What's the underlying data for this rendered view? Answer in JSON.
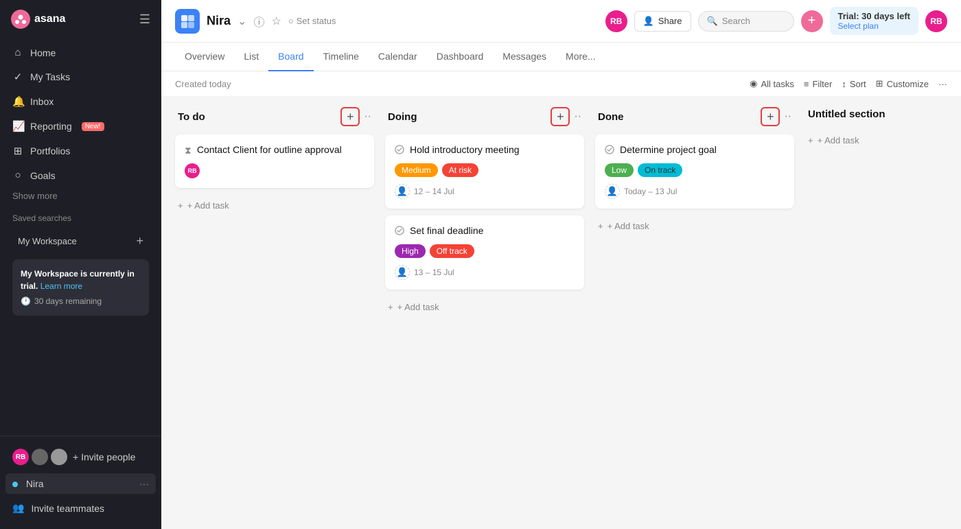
{
  "sidebar": {
    "logo_text": "asana",
    "hamburger": "☰",
    "nav_items": [
      {
        "label": "Home",
        "icon": "⌂",
        "id": "home"
      },
      {
        "label": "My Tasks",
        "icon": "✓",
        "id": "my-tasks"
      },
      {
        "label": "Inbox",
        "icon": "🔔",
        "id": "inbox"
      },
      {
        "label": "Reporting",
        "icon": "📈",
        "id": "reporting",
        "badge": "New!"
      },
      {
        "label": "Portfolios",
        "icon": "⊞",
        "id": "portfolios"
      },
      {
        "label": "Goals",
        "icon": "○",
        "id": "goals"
      }
    ],
    "show_more": "Show more",
    "saved_searches": "Saved searches",
    "my_workspace": "My Workspace",
    "trial_box": {
      "text1": "My Workspace is currently in trial.",
      "learn_more": "Learn more",
      "days_remaining": "30 days remaining"
    },
    "invite_people_label": "+ Invite people",
    "project_name": "Nira",
    "project_ellipsis": "···",
    "invite_teammates": "Invite teammates"
  },
  "topbar": {
    "project_icon": "▦",
    "project_name": "Nira",
    "set_status": "Set status",
    "share_label": "Share",
    "search_placeholder": "Search",
    "trial": {
      "title": "Trial: 30 days left",
      "select_plan": "Select plan"
    }
  },
  "nav_tabs": [
    {
      "label": "Overview",
      "id": "overview"
    },
    {
      "label": "List",
      "id": "list"
    },
    {
      "label": "Board",
      "id": "board",
      "active": true
    },
    {
      "label": "Timeline",
      "id": "timeline"
    },
    {
      "label": "Calendar",
      "id": "calendar"
    },
    {
      "label": "Dashboard",
      "id": "dashboard"
    },
    {
      "label": "Messages",
      "id": "messages"
    },
    {
      "label": "More...",
      "id": "more"
    }
  ],
  "sub_toolbar": {
    "created_today": "Created today",
    "all_tasks": "All tasks",
    "filter": "Filter",
    "sort": "Sort",
    "customize": "Customize",
    "dots": "···"
  },
  "board": {
    "columns": [
      {
        "id": "todo",
        "title": "To do",
        "tasks": [
          {
            "id": "task1",
            "title": "Contact Client for outline approval",
            "icon": "hourglass",
            "has_avatar": true,
            "avatar_text": "RB",
            "tags": []
          }
        ],
        "add_task_label": "+ Add task"
      },
      {
        "id": "doing",
        "title": "Doing",
        "tasks": [
          {
            "id": "task2",
            "title": "Hold introductory meeting",
            "icon": "circle-check",
            "tags": [
              "Medium",
              "At risk"
            ],
            "date": "12 – 14 Jul",
            "has_avatar": false
          },
          {
            "id": "task3",
            "title": "Set final deadline",
            "icon": "circle-check",
            "tags": [
              "High",
              "Off track"
            ],
            "date": "13 – 15 Jul",
            "has_avatar": false
          }
        ],
        "add_task_label": "+ Add task"
      },
      {
        "id": "done",
        "title": "Done",
        "tasks": [
          {
            "id": "task4",
            "title": "Determine project goal",
            "icon": "circle-check",
            "tags": [
              "Low",
              "On track"
            ],
            "date": "Today – 13 Jul",
            "has_avatar": false
          }
        ],
        "add_task_label": "+ Add task"
      },
      {
        "id": "untitled",
        "title": "Untitled section",
        "add_task_label": "+ Add task"
      }
    ]
  }
}
